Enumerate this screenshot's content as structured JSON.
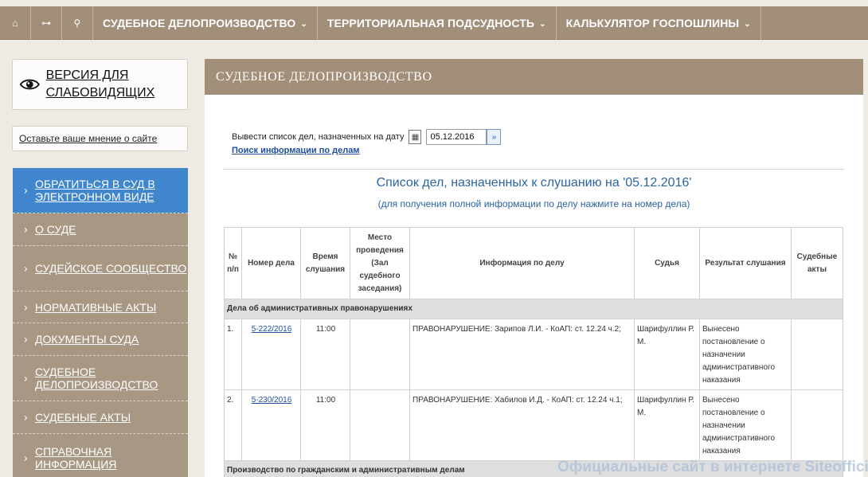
{
  "nav": {
    "home_icon": "⌂",
    "sitemap_icon": "⊶",
    "search_icon": "⚲",
    "items": [
      {
        "label": "СУДЕБНОЕ ДЕЛОПРОИЗВОДСТВО"
      },
      {
        "label": "ТЕРРИТОРИАЛЬНАЯ ПОДСУДНОСТЬ"
      },
      {
        "label": "КАЛЬКУЛЯТОР ГОСПОШЛИНЫ"
      }
    ],
    "chevron": "⌄"
  },
  "sidebar": {
    "vision_label": "ВЕРСИЯ ДЛЯ СЛАБОВИДЯЩИХ",
    "feedback_label": "Оставьте ваше мнение о сайте",
    "menu": [
      {
        "label": "ОБРАТИТЬСЯ В СУД В ЭЛЕКТРОННОМ ВИДЕ"
      },
      {
        "label": "О СУДЕ"
      },
      {
        "label": "СУДЕЙСКОЕ СООБЩЕСТВО"
      },
      {
        "label": "НОРМАТИВНЫЕ АКТЫ"
      },
      {
        "label": "ДОКУМЕНТЫ СУДА"
      },
      {
        "label": "СУДЕБНОЕ ДЕЛОПРОИЗВОДСТВО"
      },
      {
        "label": "СУДЕБНЫЕ АКТЫ"
      },
      {
        "label": "СПРАВОЧНАЯ ИНФОРМАЦИЯ"
      }
    ]
  },
  "main": {
    "heading": "СУДЕБНОЕ ДЕЛОПРОИЗВОДСТВО",
    "date_label": "Вывести список дел, назначенных на дату",
    "date_value": "05.12.2016",
    "search_link": "Поиск информации по делам",
    "list_title": "Список дел, назначенных к слушанию на '05.12.2016'",
    "list_subtitle": "(для получения полной информации по делу нажмите на номер дела)",
    "table": {
      "headers": [
        "№ п/п",
        "Номер дела",
        "Время слушания",
        "Место проведения (Зал судебного заседания)",
        "Информация по делу",
        "Судья",
        "Результат слушания",
        "Судебные акты"
      ],
      "groups": [
        {
          "title": "Дела об административных правонарушениях",
          "rows": [
            {
              "num": "1.",
              "case": "5-222/2016",
              "time": "11:00",
              "place": "",
              "info": "ПРАВОНАРУШЕНИЕ: Зарипов Л.И. - КоАП: ст. 12.24 ч.2;",
              "judge": "Шарифуллин Р. М.",
              "result": "Вынесено постановление о назначении административного наказания",
              "acts": ""
            },
            {
              "num": "2.",
              "case": "5-230/2016",
              "time": "11:00",
              "place": "",
              "info": "ПРАВОНАРУШЕНИЕ: Хабилов И.Д. - КоАП: ст. 12.24 ч.1;",
              "judge": "Шарифуллин Р. М.",
              "result": "Вынесено постановление о назначении административного наказания",
              "acts": ""
            }
          ]
        },
        {
          "title": "Производство по гражданским и административным делам",
          "rows": []
        }
      ]
    }
  },
  "watermark": "Официальные сайт в интернете Siteofficial.ru",
  "colors": {
    "nav_bg": "#a28f7a",
    "menu_bg": "#a89782",
    "menu_active": "#3f86cc",
    "link": "#1f4f98",
    "title_blue": "#2b63a3"
  }
}
